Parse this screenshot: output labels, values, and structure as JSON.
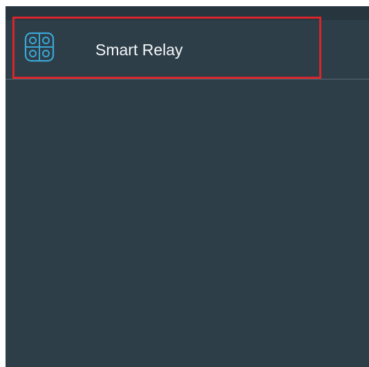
{
  "device_list": {
    "items": [
      {
        "label": "Smart Relay",
        "icon": "relay-icon"
      }
    ]
  },
  "colors": {
    "background": "#2e3e48",
    "status_strip": "#26353e",
    "icon_accent": "#3aa7d6",
    "text": "#f2f5f7",
    "highlight": "#d8262c"
  }
}
